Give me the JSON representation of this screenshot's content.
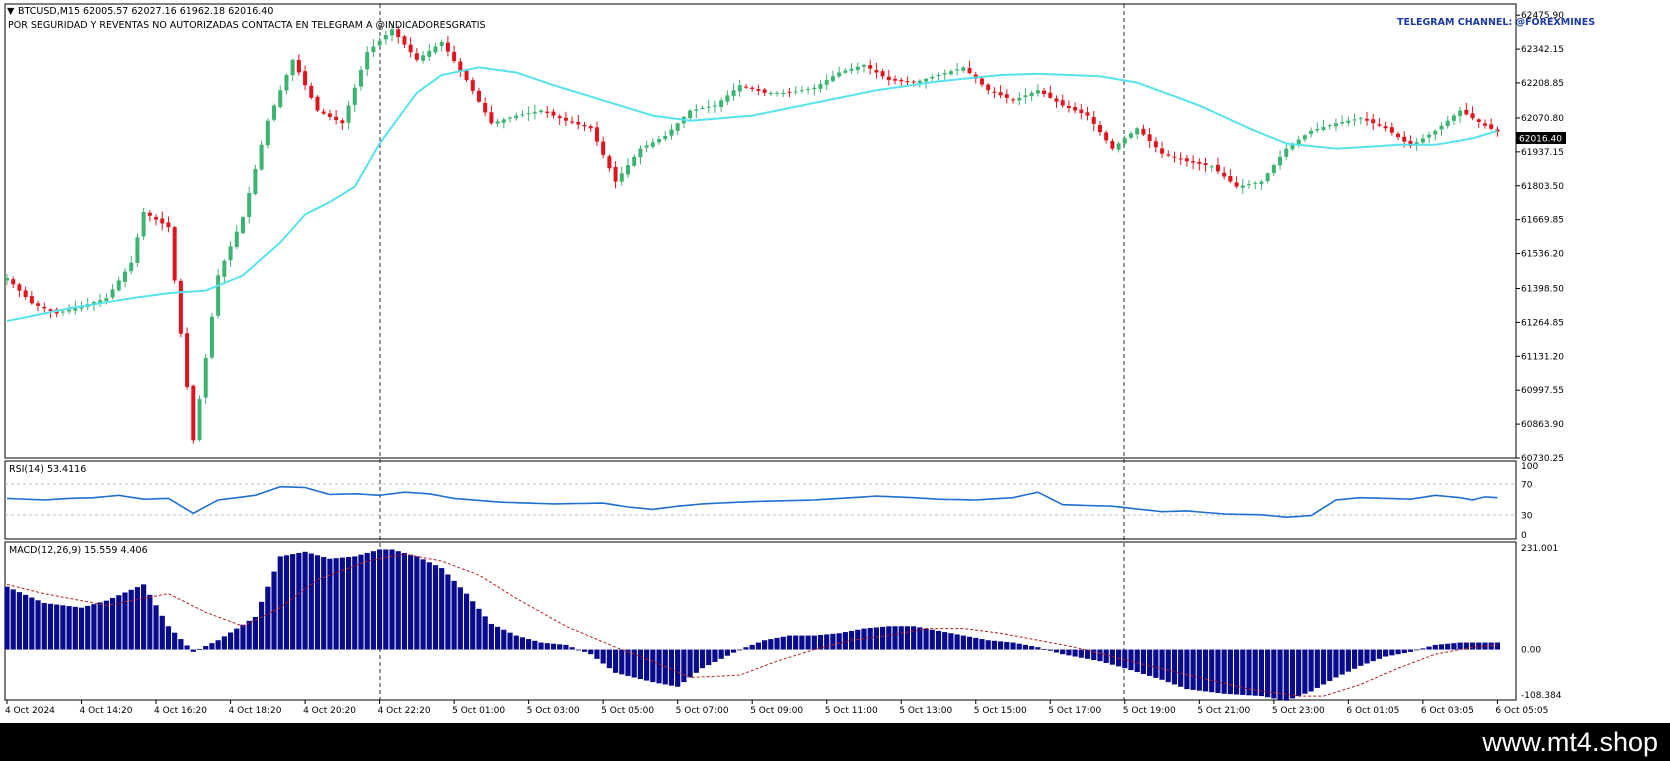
{
  "header": {
    "symbol_line": "BTCUSD,M15  62005.57 62027.16 61962.18 62016.40",
    "warning": "POR SEGURIDAD Y REVENTAS NO AUTORIZADAS CONTACTA EN TELEGRAM A @INDICADORESGRATIS",
    "telegram": "TELEGRAM CHANNEL: @FOREXMINES"
  },
  "footer": {
    "site": "www.mt4.shop"
  },
  "colors": {
    "bull": "#3cb371",
    "bear": "#e0141e",
    "ma": "#55e3ec",
    "rsi": "#1f6fd0",
    "macd": "#0a0a8c",
    "signal": "#b22222"
  },
  "chart_data": [
    {
      "type": "candlestick",
      "title": "BTCUSD,M15",
      "ohlc_header": {
        "open": 62005.57,
        "high": 62027.16,
        "low": 61962.18,
        "close": 62016.4
      },
      "current_price": "62016.40",
      "ylim": [
        60730.25,
        62520
      ],
      "y_ticks": [
        "62475.90",
        "62342.15",
        "62208.85",
        "62070.80",
        "61937.15",
        "61803.50",
        "61669.85",
        "61536.20",
        "61398.50",
        "61264.85",
        "61131.20",
        "60997.55",
        "60863.90",
        "60730.25"
      ],
      "x_ticks": [
        "4 Oct 2024",
        "4 Oct 14:20",
        "4 Oct 16:20",
        "4 Oct 18:20",
        "4 Oct 20:20",
        "4 Oct 22:20",
        "5 Oct 01:00",
        "5 Oct 03:00",
        "5 Oct 05:00",
        "5 Oct 07:00",
        "5 Oct 09:00",
        "5 Oct 11:00",
        "5 Oct 13:00",
        "5 Oct 15:00",
        "5 Oct 17:00",
        "5 Oct 19:00",
        "5 Oct 21:00",
        "5 Oct 23:00",
        "6 Oct 01:05",
        "6 Oct 03:05",
        "6 Oct 05:05"
      ],
      "ma_label": "",
      "close_anchors": [
        [
          0,
          61440
        ],
        [
          4,
          61340
        ],
        [
          8,
          61300
        ],
        [
          12,
          61330
        ],
        [
          16,
          61360
        ],
        [
          20,
          61500
        ],
        [
          22,
          61700
        ],
        [
          26,
          61640
        ],
        [
          30,
          60800
        ],
        [
          34,
          61450
        ],
        [
          38,
          61680
        ],
        [
          42,
          62060
        ],
        [
          46,
          62300
        ],
        [
          50,
          62100
        ],
        [
          54,
          62050
        ],
        [
          58,
          62330
        ],
        [
          62,
          62420
        ],
        [
          66,
          62300
        ],
        [
          70,
          62370
        ],
        [
          74,
          62220
        ],
        [
          78,
          62050
        ],
        [
          82,
          62080
        ],
        [
          86,
          62100
        ],
        [
          90,
          62060
        ],
        [
          94,
          62030
        ],
        [
          98,
          61820
        ],
        [
          102,
          61950
        ],
        [
          106,
          62000
        ],
        [
          110,
          62100
        ],
        [
          114,
          62120
        ],
        [
          118,
          62200
        ],
        [
          122,
          62170
        ],
        [
          126,
          62170
        ],
        [
          130,
          62190
        ],
        [
          134,
          62250
        ],
        [
          138,
          62280
        ],
        [
          142,
          62220
        ],
        [
          146,
          62210
        ],
        [
          150,
          62240
        ],
        [
          154,
          62270
        ],
        [
          158,
          62180
        ],
        [
          162,
          62140
        ],
        [
          166,
          62180
        ],
        [
          170,
          62120
        ],
        [
          174,
          62080
        ],
        [
          178,
          61950
        ],
        [
          182,
          62030
        ],
        [
          186,
          61930
        ],
        [
          190,
          61900
        ],
        [
          194,
          61880
        ],
        [
          198,
          61800
        ],
        [
          202,
          61820
        ],
        [
          206,
          61950
        ],
        [
          210,
          62020
        ],
        [
          214,
          62050
        ],
        [
          218,
          62070
        ],
        [
          222,
          62030
        ],
        [
          226,
          61960
        ],
        [
          230,
          62020
        ],
        [
          234,
          62100
        ],
        [
          238,
          62040
        ],
        [
          240,
          62016
        ]
      ],
      "ma_anchors": [
        [
          0,
          61270
        ],
        [
          10,
          61320
        ],
        [
          20,
          61360
        ],
        [
          26,
          61380
        ],
        [
          32,
          61390
        ],
        [
          38,
          61450
        ],
        [
          44,
          61580
        ],
        [
          48,
          61690
        ],
        [
          52,
          61740
        ],
        [
          56,
          61800
        ],
        [
          60,
          61970
        ],
        [
          66,
          62170
        ],
        [
          70,
          62240
        ],
        [
          76,
          62270
        ],
        [
          82,
          62250
        ],
        [
          88,
          62200
        ],
        [
          96,
          62140
        ],
        [
          104,
          62080
        ],
        [
          110,
          62060
        ],
        [
          120,
          62080
        ],
        [
          130,
          62130
        ],
        [
          140,
          62180
        ],
        [
          150,
          62215
        ],
        [
          160,
          62240
        ],
        [
          166,
          62245
        ],
        [
          176,
          62235
        ],
        [
          182,
          62210
        ],
        [
          192,
          62120
        ],
        [
          200,
          62030
        ],
        [
          206,
          61970
        ],
        [
          210,
          61960
        ],
        [
          214,
          61950
        ],
        [
          218,
          61955
        ],
        [
          224,
          61965
        ],
        [
          230,
          61965
        ],
        [
          236,
          61990
        ],
        [
          240,
          62020
        ]
      ]
    },
    {
      "type": "line",
      "title": "RSI(14) 53.4116",
      "ylim": [
        0,
        100
      ],
      "y_ticks": [
        "100",
        "70",
        "30",
        "0"
      ],
      "levels": [
        70,
        30
      ],
      "anchors": [
        [
          0,
          52
        ],
        [
          6,
          50
        ],
        [
          10,
          52
        ],
        [
          14,
          53
        ],
        [
          18,
          56
        ],
        [
          22,
          51
        ],
        [
          26,
          52
        ],
        [
          30,
          33
        ],
        [
          34,
          50
        ],
        [
          40,
          56
        ],
        [
          44,
          67
        ],
        [
          48,
          66
        ],
        [
          52,
          57
        ],
        [
          56,
          58
        ],
        [
          60,
          56
        ],
        [
          64,
          60
        ],
        [
          68,
          58
        ],
        [
          72,
          52
        ],
        [
          80,
          47
        ],
        [
          88,
          45
        ],
        [
          96,
          46
        ],
        [
          100,
          41
        ],
        [
          104,
          38
        ],
        [
          108,
          42
        ],
        [
          112,
          45
        ],
        [
          120,
          48
        ],
        [
          130,
          50
        ],
        [
          140,
          55
        ],
        [
          146,
          53
        ],
        [
          150,
          51
        ],
        [
          156,
          50
        ],
        [
          162,
          53
        ],
        [
          166,
          60
        ],
        [
          170,
          44
        ],
        [
          178,
          42
        ],
        [
          186,
          35
        ],
        [
          190,
          36
        ],
        [
          196,
          32
        ],
        [
          202,
          31
        ],
        [
          206,
          28
        ],
        [
          210,
          30
        ],
        [
          214,
          50
        ],
        [
          218,
          53
        ],
        [
          226,
          51
        ],
        [
          230,
          56
        ],
        [
          234,
          53
        ],
        [
          236,
          50
        ],
        [
          238,
          54
        ],
        [
          240,
          53
        ]
      ]
    },
    {
      "type": "bar",
      "title": "MACD(12,26,9) 15.559 4.406",
      "ylim": [
        -108.384,
        231.001
      ],
      "y_ticks": [
        "231.001",
        "0.00",
        "-108.384"
      ],
      "macd_anchors": [
        [
          0,
          135
        ],
        [
          6,
          100
        ],
        [
          12,
          90
        ],
        [
          16,
          105
        ],
        [
          22,
          140
        ],
        [
          26,
          50
        ],
        [
          30,
          -5
        ],
        [
          34,
          20
        ],
        [
          40,
          70
        ],
        [
          44,
          200
        ],
        [
          48,
          210
        ],
        [
          52,
          195
        ],
        [
          56,
          200
        ],
        [
          60,
          215
        ],
        [
          62,
          215
        ],
        [
          66,
          200
        ],
        [
          70,
          175
        ],
        [
          74,
          120
        ],
        [
          78,
          55
        ],
        [
          82,
          30
        ],
        [
          86,
          15
        ],
        [
          90,
          10
        ],
        [
          94,
          -10
        ],
        [
          98,
          -50
        ],
        [
          104,
          -70
        ],
        [
          108,
          -80
        ],
        [
          112,
          -40
        ],
        [
          118,
          0
        ],
        [
          122,
          20
        ],
        [
          126,
          30
        ],
        [
          130,
          30
        ],
        [
          134,
          35
        ],
        [
          138,
          45
        ],
        [
          142,
          50
        ],
        [
          146,
          50
        ],
        [
          150,
          40
        ],
        [
          154,
          30
        ],
        [
          158,
          20
        ],
        [
          162,
          15
        ],
        [
          166,
          5
        ],
        [
          170,
          -10
        ],
        [
          176,
          -25
        ],
        [
          180,
          -40
        ],
        [
          186,
          -65
        ],
        [
          190,
          -85
        ],
        [
          196,
          -95
        ],
        [
          202,
          -100
        ],
        [
          206,
          -110
        ],
        [
          210,
          -90
        ],
        [
          214,
          -60
        ],
        [
          218,
          -35
        ],
        [
          222,
          -15
        ],
        [
          226,
          -5
        ],
        [
          230,
          10
        ],
        [
          234,
          15
        ],
        [
          240,
          15
        ]
      ],
      "signal_anchors": [
        [
          0,
          140
        ],
        [
          6,
          120
        ],
        [
          12,
          105
        ],
        [
          16,
          95
        ],
        [
          22,
          110
        ],
        [
          26,
          120
        ],
        [
          32,
          80
        ],
        [
          38,
          50
        ],
        [
          44,
          90
        ],
        [
          50,
          150
        ],
        [
          58,
          190
        ],
        [
          64,
          205
        ],
        [
          70,
          190
        ],
        [
          76,
          160
        ],
        [
          82,
          110
        ],
        [
          90,
          50
        ],
        [
          98,
          5
        ],
        [
          104,
          -25
        ],
        [
          110,
          -60
        ],
        [
          118,
          -55
        ],
        [
          124,
          -25
        ],
        [
          130,
          0
        ],
        [
          136,
          20
        ],
        [
          142,
          30
        ],
        [
          148,
          45
        ],
        [
          154,
          45
        ],
        [
          160,
          35
        ],
        [
          166,
          20
        ],
        [
          172,
          5
        ],
        [
          178,
          -15
        ],
        [
          184,
          -35
        ],
        [
          192,
          -60
        ],
        [
          200,
          -85
        ],
        [
          208,
          -100
        ],
        [
          212,
          -100
        ],
        [
          218,
          -75
        ],
        [
          224,
          -40
        ],
        [
          230,
          -10
        ],
        [
          236,
          5
        ],
        [
          240,
          10
        ]
      ]
    }
  ]
}
